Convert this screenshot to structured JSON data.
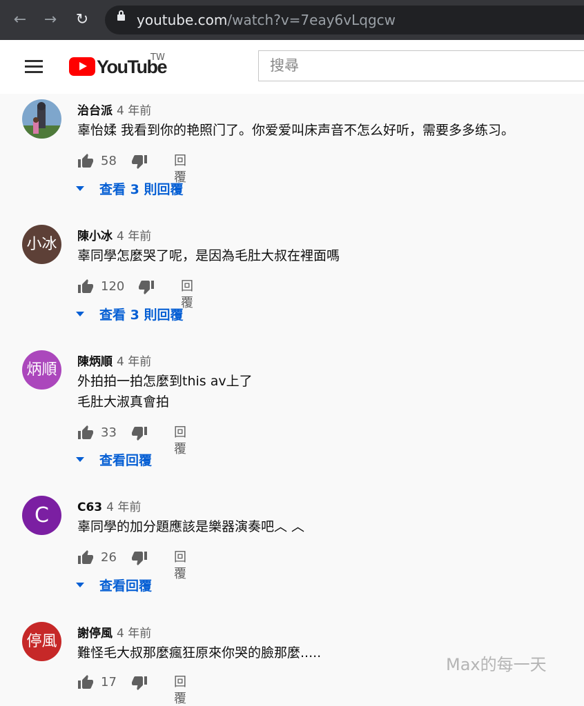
{
  "browser": {
    "url_domain": "youtube.com",
    "url_path": "/watch?v=7eay6vLqgcw"
  },
  "header": {
    "logo_text": "YouTube",
    "region": "TW",
    "search_placeholder": "搜尋"
  },
  "comments": [
    {
      "author": "治台派",
      "time": "4 年前",
      "lines": [
        "辜怡媃 我看到你的艳照门了。你爱爱叫床声音不怎么好听，需要多多练习。"
      ],
      "likes": "58",
      "reply_label": "回覆",
      "view_replies": "查看 3 則回覆",
      "avatar_text": "",
      "avatar_color": "#6b8fb8"
    },
    {
      "author": "陳小冰",
      "time": "4 年前",
      "lines": [
        "辜同學怎麼哭了呢，是因為毛肚大叔在裡面嗎"
      ],
      "likes": "120",
      "reply_label": "回覆",
      "view_replies": "查看 3 則回覆",
      "avatar_text": "小冰",
      "avatar_color": "#5d4037"
    },
    {
      "author": "陳炳順",
      "time": "4 年前",
      "lines": [
        "外拍拍一拍怎麼到this av上了",
        "毛肚大淑真會拍"
      ],
      "likes": "33",
      "reply_label": "回覆",
      "view_replies": "查看回覆",
      "avatar_text": "炳順",
      "avatar_color": "#ab47bc"
    },
    {
      "author": "C63",
      "time": "4 年前",
      "lines": [
        "辜同學的加分題應該是樂器演奏吧︿ ︿"
      ],
      "likes": "26",
      "reply_label": "回覆",
      "view_replies": "查看回覆",
      "avatar_text": "C",
      "avatar_color": "#7b1fa2"
    },
    {
      "author": "謝停風",
      "time": "4 年前",
      "lines": [
        "難怪毛大叔那麼瘋狂原來你哭的臉那麼....."
      ],
      "likes": "17",
      "reply_label": "回覆",
      "view_replies": "",
      "avatar_text": "停風",
      "avatar_color": "#c62828"
    }
  ],
  "watermark": "Max的每一天",
  "colors": {
    "link_blue": "#065fd4",
    "brand_red": "#ff0000",
    "browser_chrome": "#35363a"
  }
}
